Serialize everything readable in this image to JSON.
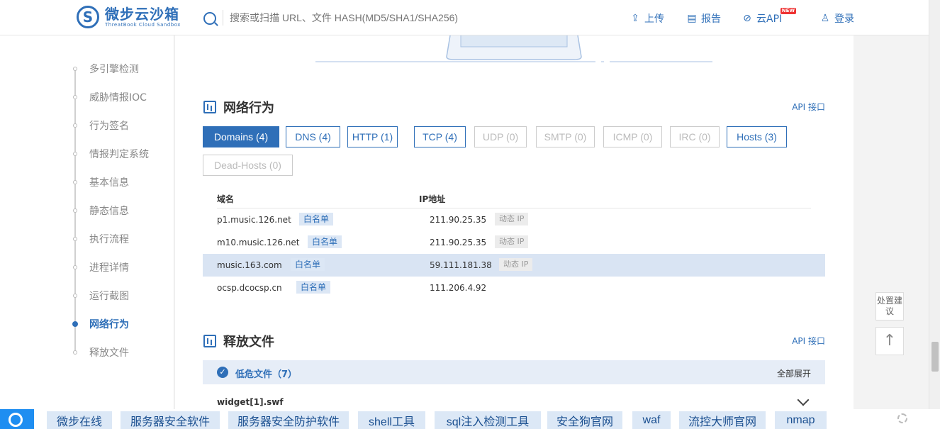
{
  "header": {
    "logo_cn": "微步云沙箱",
    "logo_en": "ThreatBook Cloud Sandbox",
    "search_placeholder": "搜索或扫描 URL、文件 HASH(MD5/SHA1/SHA256)",
    "nav": {
      "upload": "上传",
      "report": "报告",
      "cloud_api": "云API",
      "new_badge": "NEW",
      "login": "登录"
    }
  },
  "sidebar": {
    "items": [
      {
        "label": "多引擎检测"
      },
      {
        "label": "威胁情报IOC"
      },
      {
        "label": "行为签名"
      },
      {
        "label": "情报判定系统"
      },
      {
        "label": "基本信息"
      },
      {
        "label": "静态信息"
      },
      {
        "label": "执行流程"
      },
      {
        "label": "进程详情"
      },
      {
        "label": "运行截图"
      },
      {
        "label": "网络行为"
      },
      {
        "label": "释放文件"
      }
    ],
    "active_index": 9
  },
  "network": {
    "title": "网络行为",
    "api_link": "API 接口",
    "tabs": [
      {
        "label": "Domains (4)",
        "state": "active"
      },
      {
        "label": "DNS (4)",
        "state": "normal"
      },
      {
        "label": "HTTP (1)",
        "state": "normal"
      },
      {
        "label": "TCP (4)",
        "state": "normal"
      },
      {
        "label": "UDP (0)",
        "state": "disabled"
      },
      {
        "label": "SMTP (0)",
        "state": "disabled"
      },
      {
        "label": "ICMP (0)",
        "state": "disabled"
      },
      {
        "label": "IRC (0)",
        "state": "disabled"
      },
      {
        "label": "Hosts (3)",
        "state": "normal"
      },
      {
        "label": "Dead-Hosts (0)",
        "state": "disabled"
      }
    ],
    "columns": {
      "domain": "域名",
      "ip": "IP地址"
    },
    "rows": [
      {
        "domain": "p1.music.126.net",
        "tag": "白名单",
        "ip": "211.90.25.35",
        "ip_tag": "动态 IP"
      },
      {
        "domain": "m10.music.126.net",
        "tag": "白名单",
        "ip": "211.90.25.35",
        "ip_tag": "动态 IP"
      },
      {
        "domain": "music.163.com",
        "tag": "白名单",
        "ip": "59.111.181.38",
        "ip_tag": "动态 IP"
      },
      {
        "domain": "ocsp.dcocsp.cn",
        "tag": "白名单",
        "ip": "111.206.4.92",
        "ip_tag": ""
      }
    ]
  },
  "released": {
    "title": "释放文件",
    "api_link": "API 接口",
    "group_label": "低危文件（7）",
    "expand_all": "全部展开",
    "first_file": "widget[1].swf"
  },
  "right": {
    "feedback": "处置建议",
    "back_top": "↑"
  },
  "bottom_bar": {
    "items": [
      "微步在线",
      "服务器安全软件",
      "服务器安全防护软件",
      "shell工具",
      "sql注入检测工具",
      "安全狗官网",
      "waf",
      "流控大师官网",
      "nmap"
    ]
  }
}
